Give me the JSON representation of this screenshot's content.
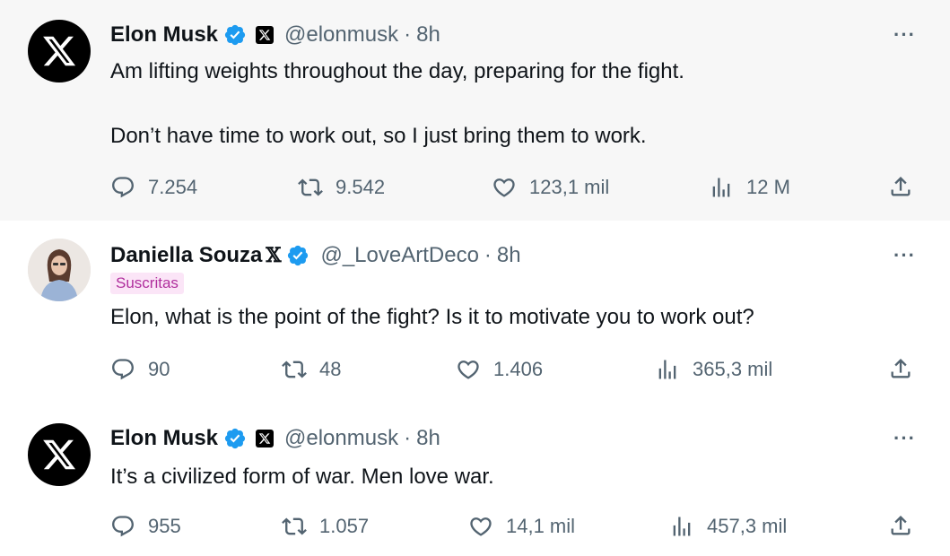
{
  "tweets": [
    {
      "name": "Elon Musk",
      "handle": "@elonmusk",
      "separator": "·",
      "time": "8h",
      "lines": [
        "Am lifting weights throughout the day, preparing for the fight.",
        "Don’t have time to work out, so I just bring them to work."
      ],
      "replies": "7.254",
      "retweets": "9.542",
      "likes": "123,1 mil",
      "views": "12 M",
      "more": "···"
    },
    {
      "name": "Daniella Souza",
      "name_x": "𝕏",
      "handle": "@_LoveArtDeco",
      "separator": "·",
      "time": "8h",
      "badge": "Suscritas",
      "lines": [
        "Elon, what is the point of the fight? Is it to motivate you to work out?"
      ],
      "replies": "90",
      "retweets": "48",
      "likes": "1.406",
      "views": "365,3 mil",
      "more": "···"
    },
    {
      "name": "Elon Musk",
      "handle": "@elonmusk",
      "separator": "·",
      "time": "8h",
      "lines": [
        "It’s a civilized form of war. Men love war."
      ],
      "replies": "955",
      "retweets": "1.057",
      "likes": "14,1 mil",
      "views": "457,3 mil",
      "more": "···"
    }
  ],
  "colors": {
    "verified": "#1d9bf0",
    "muted": "#536471",
    "text": "#0f1419",
    "thread_line": "#cfd9de",
    "highlight_bg": "#f7f7f7",
    "badge_bg": "#fbe5f7",
    "badge_text": "#b02f9d"
  }
}
